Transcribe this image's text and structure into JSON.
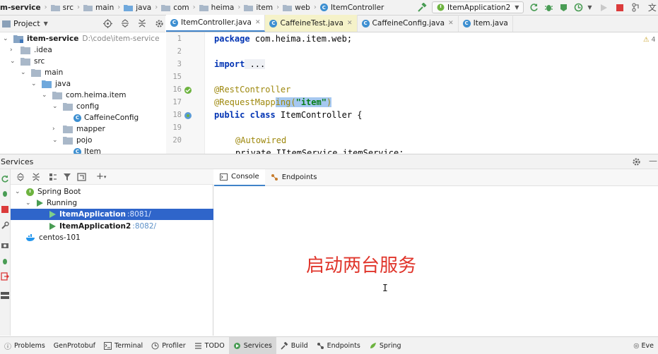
{
  "breadcrumb": {
    "items": [
      "m-service",
      "src",
      "main",
      "java",
      "com",
      "heima",
      "item",
      "web",
      "ItemController"
    ]
  },
  "toolbar": {
    "run_config": "ItemApplication2",
    "hammer_icon": "hammer-icon",
    "translate_icon": "translate-icon"
  },
  "project": {
    "title": "Project",
    "root_name": "item-service",
    "root_path": "D:\\code\\item-service",
    "tree": [
      {
        "label": ".idea"
      },
      {
        "label": "src"
      },
      {
        "label": "main"
      },
      {
        "label": "java"
      },
      {
        "label": "com.heima.item"
      },
      {
        "label": "config"
      },
      {
        "label": "CaffeineConfig"
      },
      {
        "label": "mapper"
      },
      {
        "label": "pojo"
      },
      {
        "label": "Item"
      }
    ]
  },
  "editor": {
    "tabs": [
      {
        "label": "ItemController.java",
        "active": true
      },
      {
        "label": "CaffeineTest.java",
        "active": false
      },
      {
        "label": "CaffeineConfig.java",
        "active": false
      },
      {
        "label": "Item.java",
        "active": false
      }
    ],
    "line_numbers": [
      "1",
      "2",
      "3",
      "15",
      "16",
      "17",
      "18",
      "19",
      "20"
    ],
    "inspection_count": "4",
    "code": {
      "l1_kw": "package",
      "l1_rest": " com.heima.item.web;",
      "l3_kw": "import",
      "l3_rest": " ...",
      "l16": "@RestController",
      "l17_a": "@RequestMapp",
      "l17_b": "ing(",
      "l17_str": "\"item\"",
      "l17_c": ")",
      "l18_kw": "public class",
      "l18_rest": " ItemController {",
      "l20": "@Autowired",
      "l21": "private IItemService itemService;"
    }
  },
  "services": {
    "title": "Services",
    "tree": {
      "spring_boot": "Spring Boot",
      "running": "Running",
      "app1_name": "ItemApplication",
      "app1_port": ":8081/",
      "app2_name": "ItemApplication2",
      "app2_port": ":8082/",
      "centos": "centos-101"
    },
    "console_tabs": [
      "Console",
      "Endpoints"
    ],
    "overlay_caption": "启动两台服务",
    "cursor": "I"
  },
  "bottom_tools": [
    {
      "label": "Problems",
      "icon": "problems-icon"
    },
    {
      "label": "GenProtobuf",
      "icon": ""
    },
    {
      "label": "Terminal",
      "icon": "terminal-icon"
    },
    {
      "label": "Profiler",
      "icon": "profiler-icon"
    },
    {
      "label": "TODO",
      "icon": "todo-icon"
    },
    {
      "label": "Services",
      "icon": "services-icon",
      "active": true
    },
    {
      "label": "Build",
      "icon": "build-icon"
    },
    {
      "label": "Endpoints",
      "icon": "endpoints-icon"
    },
    {
      "label": "Spring",
      "icon": "spring-icon"
    }
  ],
  "bottom_right": "Eve",
  "colors": {
    "accent": "#2f65ca",
    "run_green": "#499c54",
    "caption_red": "#e0352b"
  }
}
